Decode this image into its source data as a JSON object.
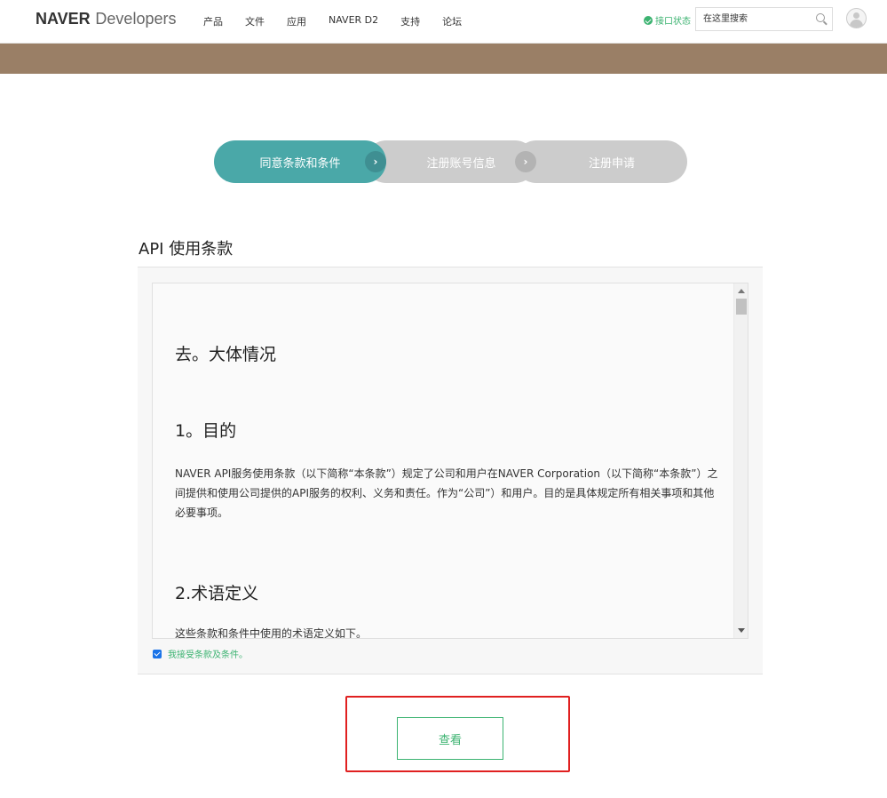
{
  "header": {
    "brand": "NAVER",
    "brand_suffix": "Developers",
    "nav": [
      "产品",
      "文件",
      "应用",
      "NAVER D2",
      "支持",
      "论坛"
    ],
    "status_label": "接口状态",
    "search_placeholder": "在这里搜索"
  },
  "steps": [
    {
      "label": "同意条款和条件",
      "active": true
    },
    {
      "label": "注册账号信息",
      "active": false
    },
    {
      "label": "注册申请",
      "active": false
    }
  ],
  "section": {
    "title": "API 使用条款"
  },
  "terms": {
    "heading_general": "去。大体情况",
    "heading_purpose": "1。目的",
    "purpose_text": "NAVER API服务使用条款（以下简称“本条款”）规定了公司和用户在NAVER Corporation（以下简称“本条款”）之间提供和使用公司提供的API服务的权利、义务和责任。作为“公司”）和用户。目的是具体规定所有相关事项和其他必要事项。",
    "heading_terms": "2.术语定义",
    "terms_text": "这些条款和条件中使用的术语定义如下。"
  },
  "agree": {
    "label": "我接受条款及条件。",
    "checked": true
  },
  "button": {
    "view_label": "查看"
  },
  "colors": {
    "accent": "#4aa8a8",
    "banner": "#9a7f66",
    "green": "#3cb371",
    "highlight": "#e02020"
  }
}
